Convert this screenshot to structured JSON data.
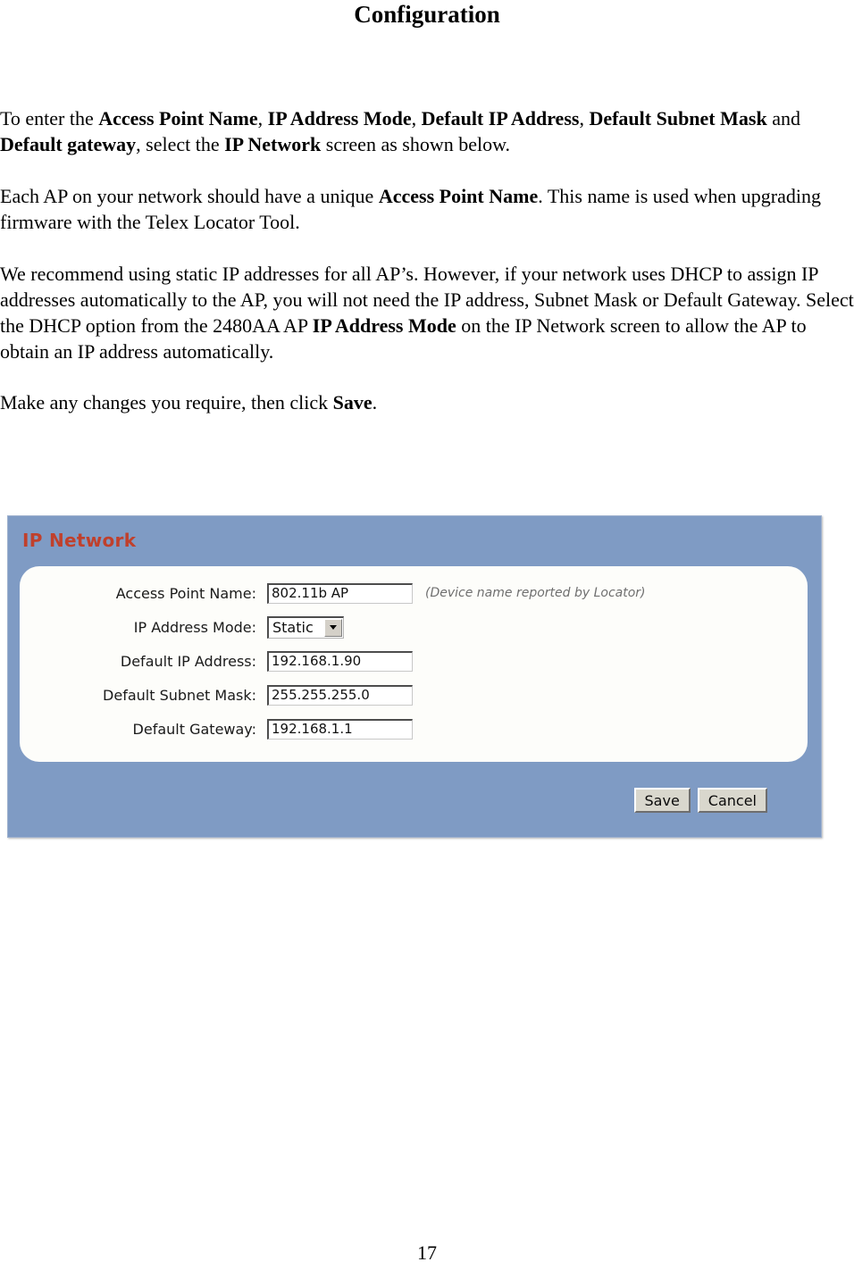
{
  "document": {
    "heading": "Configuration",
    "page_number": "17",
    "paragraphs": [
      {
        "id": "para-1",
        "runs": [
          {
            "text": "To enter the ",
            "bold": false
          },
          {
            "text": "Access Point Name",
            "bold": true
          },
          {
            "text": ", ",
            "bold": false
          },
          {
            "text": "IP Address Mode",
            "bold": true
          },
          {
            "text": ", ",
            "bold": false
          },
          {
            "text": "Default IP Address",
            "bold": true
          },
          {
            "text": ", ",
            "bold": false
          },
          {
            "text": "Default Subnet Mask",
            "bold": true
          },
          {
            "text": " and ",
            "bold": false
          },
          {
            "text": "Default gateway",
            "bold": true
          },
          {
            "text": ", select the ",
            "bold": false
          },
          {
            "text": "IP Network",
            "bold": true
          },
          {
            "text": " screen as shown below.",
            "bold": false
          }
        ]
      },
      {
        "id": "para-2",
        "runs": [
          {
            "text": "Each AP on your network should have a unique ",
            "bold": false
          },
          {
            "text": "Access Point Name",
            "bold": true
          },
          {
            "text": ".  This name is used when upgrading firmware with the Telex Locator Tool.",
            "bold": false
          }
        ]
      },
      {
        "id": "para-3",
        "runs": [
          {
            "text": "We recommend using static IP addresses for all AP’s.  However, if your network uses DHCP to assign IP addresses automatically to the AP, you will not need the IP address, Subnet Mask or Default Gateway.  Select the DHCP option from the 2480AA AP ",
            "bold": false
          },
          {
            "text": "IP Address Mode",
            "bold": true
          },
          {
            "text": " on the IP Network screen to allow the AP to obtain an IP address automatically.",
            "bold": false
          }
        ]
      },
      {
        "id": "para-4",
        "runs": [
          {
            "text": "Make any changes you require, then click ",
            "bold": false
          },
          {
            "text": "Save",
            "bold": true
          },
          {
            "text": ".",
            "bold": false
          }
        ]
      }
    ]
  },
  "screenshot": {
    "panel_title": "IP Network",
    "colors": {
      "panel_background": "#7f9bc4",
      "panel_title_text": "#c0402c",
      "inner_background": "#fdfdfa",
      "button_face": "#d9d7cd"
    },
    "fields": [
      {
        "label": "Access Point Name:",
        "type": "text",
        "value": "802.11b AP",
        "hint": "(Device name reported by Locator)"
      },
      {
        "label": "IP Address Mode:",
        "type": "select",
        "value": "Static",
        "hint": ""
      },
      {
        "label": "Default IP Address:",
        "type": "text",
        "value": "192.168.1.90",
        "hint": ""
      },
      {
        "label": "Default Subnet Mask:",
        "type": "text",
        "value": "255.255.255.0",
        "hint": ""
      },
      {
        "label": "Default Gateway:",
        "type": "text",
        "value": "192.168.1.1",
        "hint": ""
      }
    ],
    "buttons": [
      {
        "label": "Save",
        "name": "save-button"
      },
      {
        "label": "Cancel",
        "name": "cancel-button"
      }
    ]
  }
}
